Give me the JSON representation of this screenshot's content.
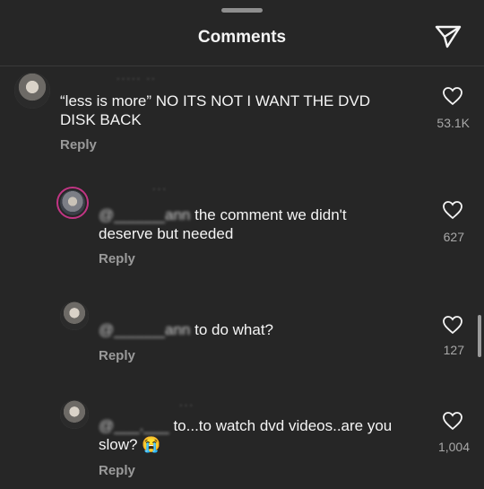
{
  "header": {
    "title": "Comments",
    "share_icon": "send-icon"
  },
  "comments": [
    {
      "username": "····· ··",
      "text_before": "",
      "text": "“less is more” NO ITS NOT I WANT THE DVD DISK BACK",
      "reply_label": "Reply",
      "likes": "53.1K",
      "like_icon": "heart-outline-icon"
    },
    {
      "username": "···",
      "mention": "@______ann",
      "text": "the comment we didn't deserve but needed",
      "reply_label": "Reply",
      "likes": "627",
      "like_icon": "heart-outline-icon"
    },
    {
      "username": "",
      "mention": "@______ann",
      "text": "to do what?",
      "reply_label": "Reply",
      "likes": "127",
      "like_icon": "heart-outline-icon"
    },
    {
      "username": "···",
      "mention": "@___.___",
      "text": "to...to watch dvd videos..are you slow?",
      "emoji": "😭",
      "reply_label": "Reply",
      "likes": "1,004",
      "like_icon": "heart-outline-icon"
    }
  ],
  "colors": {
    "background": "#262626",
    "text": "#f5f5f5",
    "muted": "#9a9a9a"
  }
}
